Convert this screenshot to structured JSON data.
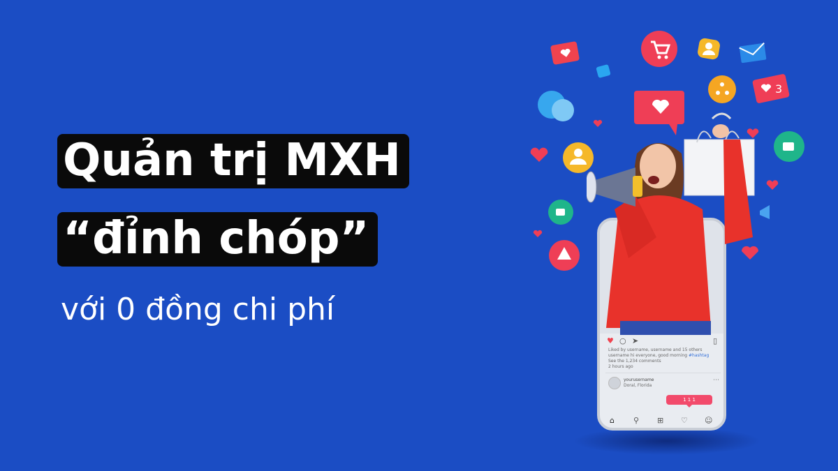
{
  "headline": {
    "line1": "Quản trị MXH",
    "line2": "“đỉnh chóp”",
    "subline": "với 0 đồng chi phí"
  },
  "phone": {
    "liked_line": "Liked by username, username and 15 others",
    "caption_user": "username",
    "caption_text": "hi everyone, good morning",
    "caption_hashtag": "#hashtag",
    "comments_link": "See the 1,234 comments",
    "post_time": "2 hours ago",
    "profile_name": "yourusername",
    "profile_location": "Doral, Florida",
    "notification": "1  1  1"
  },
  "floating_icons": {
    "heart_badge_count": "3"
  },
  "colors": {
    "background": "#1b4dc4",
    "headline_box": "#0a0a0a",
    "notification_pink": "#f24a6b",
    "sweater_red": "#e8322b"
  }
}
